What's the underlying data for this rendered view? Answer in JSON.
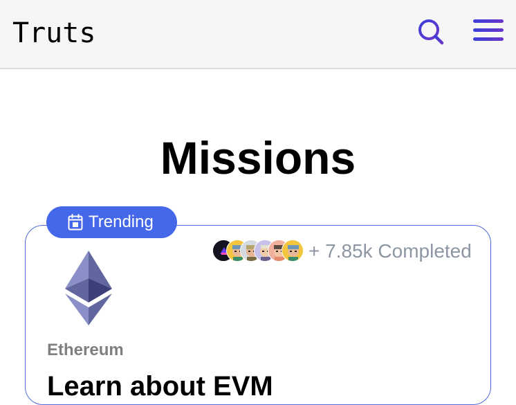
{
  "header": {
    "logo_text": "Truts",
    "search_icon": "search-icon",
    "menu_icon": "hamburger-menu-icon",
    "accent_color": "#4a3fd0"
  },
  "page": {
    "title": "Missions"
  },
  "mission_card": {
    "badge_label": "Trending",
    "badge_icon": "calendar-icon",
    "badge_color": "#4468e9",
    "completed_text": "+ 7.85k Completed",
    "network_label": "Ethereum",
    "title": "Learn about EVM",
    "avatars": [
      "avatar-1",
      "avatar-2",
      "avatar-3",
      "avatar-4",
      "avatar-5",
      "avatar-6"
    ]
  }
}
